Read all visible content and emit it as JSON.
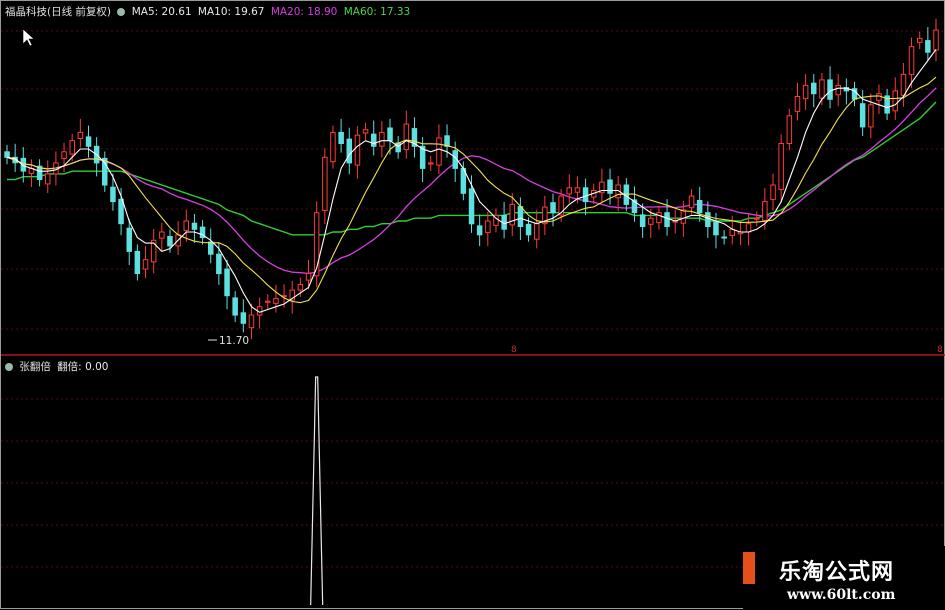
{
  "stock_title": "福晶科技(日线 前复权)",
  "indicators": [
    {
      "label": "MA5: 20.61",
      "color": "#e8e8e8"
    },
    {
      "label": "MA10: 19.67",
      "color": "#e8e8e8"
    },
    {
      "label": "MA20: 18.90",
      "color": "#d63fe0"
    },
    {
      "label": "MA60: 17.33",
      "color": "#4cd64c"
    }
  ],
  "low_price_label": "11.70",
  "marker_mid": "8",
  "marker_right": "8",
  "sub_panel": {
    "title": "张翻倍",
    "value_label": "翻倍: 0.00"
  },
  "watermark": {
    "title": "乐淘公式网",
    "url": "www.60lt.com"
  },
  "colors": {
    "up": "#ff3a3a",
    "down": "#5fe0e0",
    "ma5": "#ffffff",
    "ma10": "#f0e24a",
    "ma20": "#d63fe0",
    "ma60": "#33cc33",
    "grid": "#7a1010",
    "divider": "#b01818"
  },
  "chart_data": {
    "type": "candlestick",
    "price_range": [
      11,
      23
    ],
    "closes": [
      18.0,
      17.8,
      17.5,
      17.6,
      17.2,
      17.4,
      17.8,
      18.2,
      18.6,
      18.9,
      18.4,
      17.8,
      17.0,
      16.4,
      15.6,
      14.6,
      13.8,
      14.3,
      15.0,
      15.3,
      14.8,
      15.2,
      15.7,
      15.4,
      15.1,
      14.5,
      13.8,
      13.0,
      12.3,
      12.0,
      12.3,
      12.6,
      12.8,
      12.9,
      13.0,
      13.2,
      13.4,
      13.8,
      16.0,
      18.0,
      18.9,
      18.5,
      17.8,
      18.8,
      19.0,
      18.4,
      18.9,
      18.6,
      18.2,
      19.2,
      18.4,
      17.6,
      17.8,
      18.7,
      18.4,
      17.6,
      16.7,
      15.6,
      15.2,
      15.7,
      15.9,
      15.4,
      16.3,
      15.5,
      15.2,
      15.6,
      16.2,
      16.0,
      16.6,
      16.9,
      16.9,
      16.4,
      16.8,
      17.1,
      16.7,
      17.0,
      16.3,
      16.0,
      15.5,
      15.8,
      16.0,
      15.5,
      15.7,
      16.1,
      16.6,
      16.0,
      15.5,
      15.2,
      15.1,
      15.4,
      15.3,
      15.6,
      15.8,
      16.4,
      17.0,
      18.5,
      19.5,
      20.2,
      20.6,
      20.3,
      20.8,
      20.1,
      20.6,
      20.4,
      20.1,
      19.1,
      19.9,
      20.3,
      19.6,
      20.4,
      21.0,
      22.0,
      22.3,
      21.8,
      22.6
    ],
    "ma5": [
      18.0,
      17.95,
      17.7,
      17.6,
      17.5,
      17.5,
      17.55,
      17.7,
      18.0,
      18.3,
      18.3,
      18.1,
      17.8,
      17.3,
      16.6,
      15.7,
      15.1,
      14.9,
      14.9,
      14.6,
      14.7,
      15.0,
      15.3,
      15.3,
      15.2,
      15.0,
      14.7,
      14.2,
      13.7,
      13.1,
      12.6,
      12.4,
      12.5,
      12.6,
      12.7,
      12.9,
      13.1,
      13.3,
      14.0,
      15.2,
      16.5,
      17.6,
      18.1,
      18.4,
      18.6,
      18.5,
      18.6,
      18.6,
      18.4,
      18.6,
      18.5,
      18.3,
      18.2,
      18.3,
      18.2,
      18.0,
      17.6,
      17.0,
      16.4,
      16.1,
      15.8,
      15.6,
      15.7,
      15.8,
      15.7,
      15.6,
      15.7,
      15.8,
      16.0,
      16.3,
      16.5,
      16.6,
      16.7,
      16.8,
      16.8,
      16.8,
      16.6,
      16.4,
      16.2,
      16.0,
      15.9,
      15.8,
      15.7,
      15.8,
      15.9,
      15.9,
      15.8,
      15.7,
      15.6,
      15.4,
      15.3,
      15.3,
      15.4,
      15.6,
      15.9,
      16.4,
      17.2,
      18.0,
      18.9,
      19.6,
      20.1,
      20.4,
      20.5,
      20.5,
      20.4,
      20.1,
      20.0,
      19.9,
      19.8,
      19.9,
      20.2,
      20.7,
      21.1,
      21.5,
      21.9
    ],
    "ma60": [
      17.2,
      17.2,
      17.3,
      17.3,
      17.3,
      17.4,
      17.4,
      17.4,
      17.5,
      17.5,
      17.5,
      17.5,
      17.5,
      17.5,
      17.5,
      17.4,
      17.3,
      17.2,
      17.1,
      17.0,
      16.9,
      16.8,
      16.7,
      16.6,
      16.5,
      16.4,
      16.3,
      16.1,
      16.0,
      15.9,
      15.7,
      15.6,
      15.5,
      15.4,
      15.3,
      15.2,
      15.2,
      15.2,
      15.2,
      15.2,
      15.3,
      15.3,
      15.4,
      15.4,
      15.5,
      15.5,
      15.6,
      15.6,
      15.7,
      15.7,
      15.8,
      15.8,
      15.8,
      15.9,
      15.9,
      15.9,
      15.9,
      15.9,
      15.9,
      15.9,
      15.9,
      15.9,
      16.0,
      16.0,
      16.0,
      16.0,
      16.0,
      16.0,
      16.0,
      16.0,
      16.0,
      16.0,
      16.0,
      16.0,
      16.0,
      16.0,
      16.0,
      15.9,
      15.9,
      15.9,
      15.9,
      15.8,
      15.8,
      15.8,
      15.8,
      15.8,
      15.7,
      15.7,
      15.7,
      15.7,
      15.7,
      15.8,
      15.8,
      15.9,
      16.0,
      16.1,
      16.3,
      16.5,
      16.7,
      16.9,
      17.1,
      17.3,
      17.5,
      17.7,
      17.9,
      18.0,
      18.2,
      18.4,
      18.6,
      18.8,
      19.0,
      19.2,
      19.4,
      19.7,
      20.0
    ],
    "spike": {
      "index": 38,
      "value": 1
    }
  }
}
